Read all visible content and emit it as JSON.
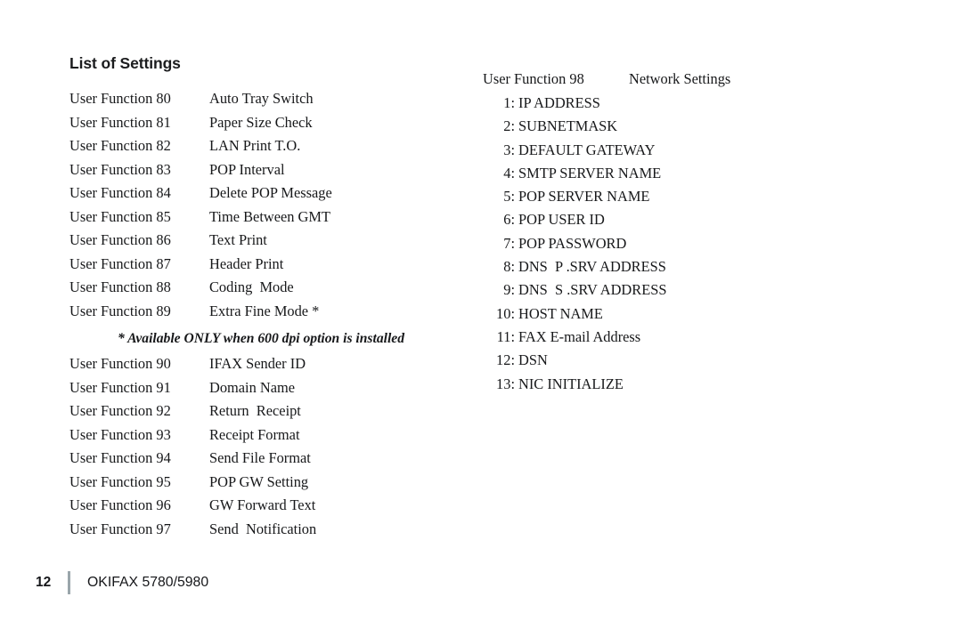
{
  "document": {
    "heading": "List of Settings"
  },
  "left_column": {
    "label_prefix": "User Function",
    "rows_part1": [
      {
        "function": "User Function 80",
        "setting": "Auto Tray Switch"
      },
      {
        "function": "User Function 81",
        "setting": "Paper Size Check"
      },
      {
        "function": "User Function 82",
        "setting": "LAN Print T.O."
      },
      {
        "function": "User Function 83",
        "setting": "POP Interval"
      },
      {
        "function": "User Function 84",
        "setting": "Delete POP Message"
      },
      {
        "function": "User Function 85",
        "setting": "Time Between GMT"
      },
      {
        "function": "User Function 86",
        "setting": "Text Print"
      },
      {
        "function": "User Function 87",
        "setting": "Header Print"
      },
      {
        "function": "User Function 88",
        "setting": "Coding  Mode"
      },
      {
        "function": "User Function 89",
        "setting": "Extra Fine Mode *"
      }
    ],
    "footnote": "* Available ONLY when 600 dpi option is installed",
    "rows_part2": [
      {
        "function": "User Function 90",
        "setting": "IFAX Sender ID"
      },
      {
        "function": "User Function 91",
        "setting": "Domain Name"
      },
      {
        "function": "User Function 92",
        "setting": "Return  Receipt"
      },
      {
        "function": "User Function 93",
        "setting": "Receipt Format"
      },
      {
        "function": "User Function 94",
        "setting": "Send File Format"
      },
      {
        "function": "User Function 95",
        "setting": "POP GW Setting"
      },
      {
        "function": "User Function 96",
        "setting": "GW Forward Text"
      },
      {
        "function": "User Function 97",
        "setting": "Send  Notification"
      }
    ]
  },
  "right_column": {
    "header": {
      "function": "User Function 98",
      "setting": "Network Settings"
    },
    "network_settings": [
      {
        "number": "1:",
        "name": "IP ADDRESS"
      },
      {
        "number": "2:",
        "name": "SUBNETMASK"
      },
      {
        "number": "3:",
        "name": "DEFAULT GATEWAY"
      },
      {
        "number": "4:",
        "name": "SMTP SERVER NAME"
      },
      {
        "number": "5:",
        "name": "POP SERVER NAME"
      },
      {
        "number": "6:",
        "name": "POP USER ID"
      },
      {
        "number": "7:",
        "name": "POP PASSWORD"
      },
      {
        "number": "8:",
        "name": "DNS  P .SRV ADDRESS"
      },
      {
        "number": "9:",
        "name": "DNS  S .SRV ADDRESS"
      },
      {
        "number": "10:",
        "name": "HOST NAME"
      },
      {
        "number": "11:",
        "name": "FAX E-mail Address"
      },
      {
        "number": "12:",
        "name": "DSN"
      },
      {
        "number": "13:",
        "name": "NIC INITIALIZE"
      }
    ]
  },
  "footer": {
    "page_number": "12",
    "title": "OKIFAX 5780/5980",
    "divider_color": "#9aa6ab"
  }
}
